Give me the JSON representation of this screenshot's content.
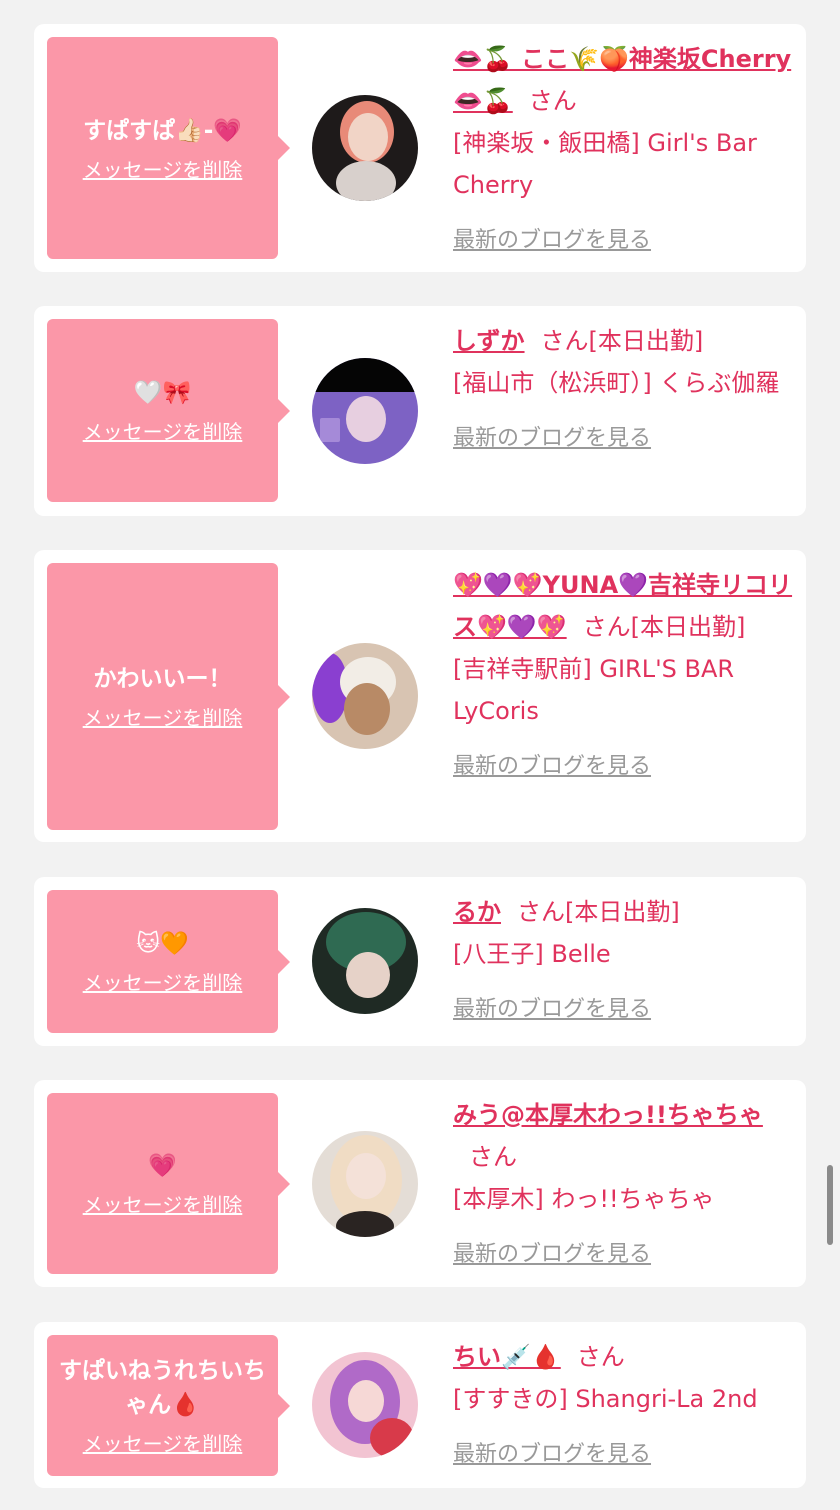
{
  "entries": [
    {
      "message": "すぱすぱ👍🏻-💗",
      "delete_label": "メッセージを削除",
      "name": "👄🍒 ここ🌾🍑神楽坂Cherry👄🍒",
      "san": "さん",
      "badge": "",
      "shop": "[神楽坂・飯田橋] Girl's Bar Cherry",
      "blog_label": "最新のブログを見る"
    },
    {
      "message": "🤍🎀",
      "delete_label": "メッセージを削除",
      "name": "しずか",
      "san": "さん",
      "badge": "[本日出勤]",
      "shop": "[福山市（松浜町）] くらぶ伽羅",
      "blog_label": "最新のブログを見る"
    },
    {
      "message": "かわいいー！",
      "delete_label": "メッセージを削除",
      "name": "💖💜💖YUNA💜吉祥寺リコリス💖💜💖",
      "san": "さん",
      "badge": "[本日出勤]",
      "shop": "[吉祥寺駅前] GIRL'S BAR LyCoris",
      "blog_label": "最新のブログを見る"
    },
    {
      "message": "🐱🧡",
      "delete_label": "メッセージを削除",
      "name": "るか",
      "san": "さん",
      "badge": "[本日出勤]",
      "shop": "[八王子] Belle",
      "blog_label": "最新のブログを見る"
    },
    {
      "message": "💗",
      "delete_label": "メッセージを削除",
      "name": "みう@本厚木わっ!!ちゃちゃ",
      "san": "さん",
      "badge": "",
      "shop": "[本厚木] わっ!!ちゃちゃ",
      "blog_label": "最新のブログを見る"
    },
    {
      "message": "すぱいねうれちいちゃん🩸",
      "delete_label": "メッセージを削除",
      "name": "ちい💉🩸",
      "san": "さん",
      "badge": "",
      "shop": "[すすきの] Shangri-La 2nd",
      "blog_label": "最新のブログを見る"
    }
  ],
  "colors": {
    "background": "#f2f2f2",
    "card": "#ffffff",
    "bubble": "#fb97a8",
    "accent": "#e0325d",
    "muted_link": "#999999"
  },
  "icons": {
    "scrollbar": "vertical-scrollbar"
  }
}
